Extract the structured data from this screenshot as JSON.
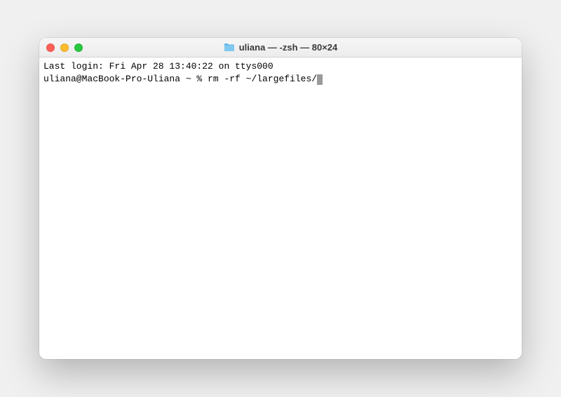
{
  "window": {
    "title": "uliana — -zsh — 80×24"
  },
  "terminal": {
    "line1": "Last login: Fri Apr 28 13:40:22 on ttys000",
    "prompt": "uliana@MacBook-Pro-Uliana ~ % ",
    "command": "rm -rf ~/largefiles/"
  },
  "colors": {
    "window_bg": "#ffffff",
    "titlebar_bg": "#ececec",
    "text": "#000000",
    "cursor": "#9a9a9a"
  }
}
